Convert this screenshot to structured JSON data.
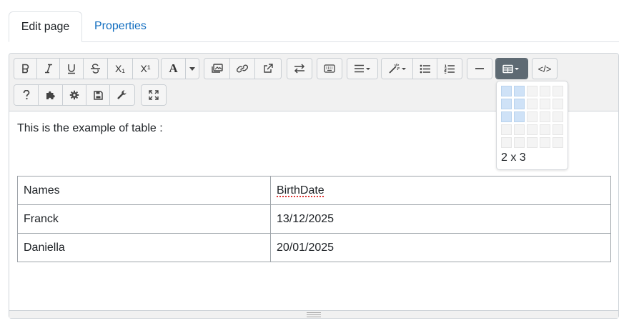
{
  "tabs": [
    {
      "label": "Edit page",
      "active": true
    },
    {
      "label": "Properties",
      "active": false
    }
  ],
  "toolbar": {
    "row1": [
      [
        "bold-icon",
        "italic-icon",
        "underline-icon",
        "strikethrough-icon",
        "subscript-icon",
        "superscript-icon"
      ],
      [
        "font-color-icon",
        "caret-down-icon"
      ],
      [
        "image-icon",
        "link-icon",
        "external-link-icon"
      ],
      [
        "direction-icon"
      ],
      [
        "keyboard-icon"
      ],
      [
        "align-icon"
      ],
      [
        "magic-wand-icon",
        "bullet-list-icon",
        "numbered-list-icon"
      ],
      [
        "horizontal-rule-icon"
      ],
      [
        "table-icon"
      ],
      [
        "code-icon"
      ]
    ],
    "row2": [
      [
        "help-icon",
        "puzzle-icon",
        "gear-icon",
        "save-icon",
        "wrench-icon"
      ],
      [
        "fullscreen-icon"
      ]
    ],
    "subscript_label": "X₁",
    "superscript_label": "X¹",
    "font_label": "A",
    "code_label": "</>"
  },
  "content": {
    "intro": "This is the example of table :",
    "table": {
      "rows": [
        [
          "Names",
          "BirthDate"
        ],
        [
          "Franck",
          "13/12/2025"
        ],
        [
          "Daniella",
          "20/01/2025"
        ]
      ]
    }
  },
  "table_picker": {
    "cols_selected": 2,
    "rows_selected": 3,
    "grid_size": 5,
    "label": "2 x 3"
  },
  "colors": {
    "link": "#0f6cbf",
    "active_button": "#5e6a73",
    "picker_highlight": "#cfe2f7"
  }
}
